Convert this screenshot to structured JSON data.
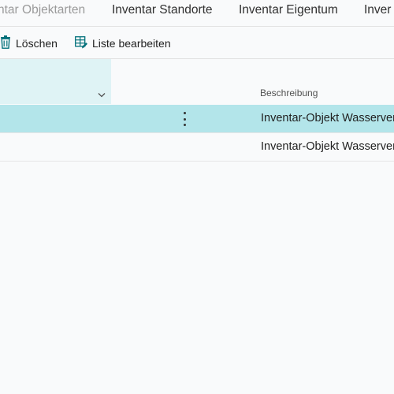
{
  "tabs": [
    {
      "label": "ntar Objektarten"
    },
    {
      "label": "Inventar Standorte"
    },
    {
      "label": "Inventar Eigentum"
    },
    {
      "label": "Inver"
    }
  ],
  "toolbar": {
    "delete_label": "Löschen",
    "edit_list_label": "Liste bearbeiten"
  },
  "grid": {
    "column_header_description": "Beschreibung",
    "rows": [
      {
        "description": "Inventar-Objekt Wasserver",
        "selected": true
      },
      {
        "description": "Inventar-Objekt Wasserver",
        "selected": false
      }
    ]
  },
  "colors": {
    "selected_row": "#b3e5ea",
    "selected_header": "#dff3f5",
    "page_bg": "#f9fafb",
    "icon_accent": "#00707a"
  }
}
